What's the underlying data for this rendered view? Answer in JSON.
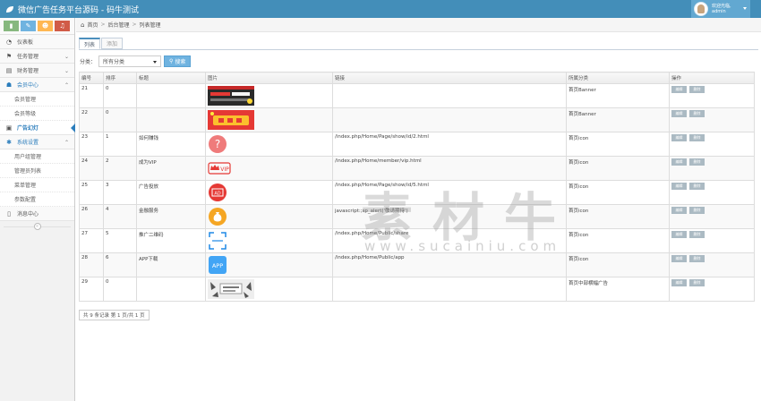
{
  "app": {
    "title": "微信广告任务平台源码 - 码牛测试"
  },
  "user": {
    "greeting": "欢迎光临,",
    "name": "admin"
  },
  "shortcuts": [
    {
      "icon": "chart-icon",
      "glyph": "▮",
      "color": "#87b87f"
    },
    {
      "icon": "pencil-icon",
      "glyph": "✎",
      "color": "#6fb3e0"
    },
    {
      "icon": "users-icon",
      "glyph": "☻",
      "color": "#ffb752"
    },
    {
      "icon": "bell-icon",
      "glyph": "♫",
      "color": "#d15b47"
    }
  ],
  "sidebar": {
    "items": [
      {
        "label": "仪表板",
        "glyph": "◔"
      },
      {
        "label": "任务管理",
        "glyph": "⚑"
      },
      {
        "label": "财务管理",
        "glyph": "▤"
      },
      {
        "label": "会员中心",
        "glyph": "☗",
        "children": [
          "会员管理",
          "会员等级"
        ]
      },
      {
        "label": "广告幻灯",
        "glyph": "▣"
      },
      {
        "label": "系统设置",
        "glyph": "✱",
        "children": [
          "用户组管理",
          "管理员列表",
          "菜单管理",
          "参数配置"
        ]
      },
      {
        "label": "消息中心",
        "glyph": "▯"
      }
    ]
  },
  "breadcrumbs": [
    "首页",
    "后台管理",
    "列表管理"
  ],
  "tabs": [
    "列表",
    "添加"
  ],
  "filter": {
    "label": "分类：",
    "selected": "所有分类",
    "search_label": "搜索"
  },
  "table": {
    "headers": [
      "编号",
      "排序",
      "标题",
      "图片",
      "链接",
      "所属分类",
      "操作"
    ],
    "rows": [
      {
        "id": "21",
        "sort": "0",
        "title": "",
        "image": "banner-dark",
        "link": "",
        "category": "首页Banner"
      },
      {
        "id": "22",
        "sort": "0",
        "title": "",
        "image": "banner-red",
        "link": "",
        "category": "首页Banner"
      },
      {
        "id": "23",
        "sort": "1",
        "title": "如何赚钱",
        "image": "question-icon",
        "link": "/index.php/Home/Page/show/id/2.html",
        "category": "首页icon"
      },
      {
        "id": "24",
        "sort": "2",
        "title": "成为VIP",
        "image": "vip-icon",
        "link": "/index.php/Home/member/vip.html",
        "category": "首页icon"
      },
      {
        "id": "25",
        "sort": "3",
        "title": "广告投放",
        "image": "ad-icon",
        "link": "/index.php/Home/Page/show/id/5.html",
        "category": "首页icon"
      },
      {
        "id": "26",
        "sort": "4",
        "title": "金融服务",
        "image": "money-bag-icon",
        "link": "javascript:;sp_alert('敬请期待')",
        "category": "首页icon"
      },
      {
        "id": "27",
        "sort": "5",
        "title": "推广二维码",
        "image": "scan-icon",
        "link": "/index.php/Home/Public/share",
        "category": "首页icon"
      },
      {
        "id": "28",
        "sort": "6",
        "title": "APP下载",
        "image": "app-icon",
        "link": "/index.php/Home/Public/app",
        "category": "首页icon"
      },
      {
        "id": "29",
        "sort": "0",
        "title": "",
        "image": "banner-ad",
        "link": "",
        "category": "首页中部横幅广告"
      }
    ],
    "edit_label": "编辑",
    "delete_label": "删除"
  },
  "pager": "共 9 条记录 第 1 页/共 1 页",
  "watermark": {
    "text": "素材牛",
    "url": "www.sucainiu.com"
  }
}
